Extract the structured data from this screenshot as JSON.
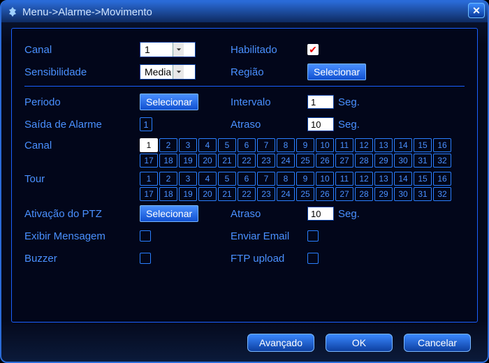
{
  "title": "Menu->Alarme->Movimento",
  "labels": {
    "canal": "Canal",
    "sensibilidade": "Sensibilidade",
    "habilitado": "Habilitado",
    "regiao": "Região",
    "periodo": "Periodo",
    "intervalo": "Intervalo",
    "saida": "Saída de Alarme",
    "atraso": "Atraso",
    "canal_rec": "Canal",
    "tour": "Tour",
    "ptz": "Ativação do PTZ",
    "atraso2": "Atraso",
    "exibir": "Exibir Mensagem",
    "enviar": "Enviar Email",
    "buzzer": "Buzzer",
    "ftp": "FTP upload",
    "seg": "Seg."
  },
  "values": {
    "canal_select": "1",
    "sens_select": "Media",
    "habilitado_checked": true,
    "intervalo": "1",
    "atraso1": "10",
    "atraso2": "10",
    "alarm_output": "1",
    "rec_selected": [
      1
    ],
    "tour_selected": [],
    "exibir": false,
    "enviar": false,
    "buzzer": false,
    "ftp": false
  },
  "buttons": {
    "selecionar": "Selecionar",
    "avancado": "Avançado",
    "ok": "OK",
    "cancelar": "Cancelar"
  },
  "channel_count": 32
}
